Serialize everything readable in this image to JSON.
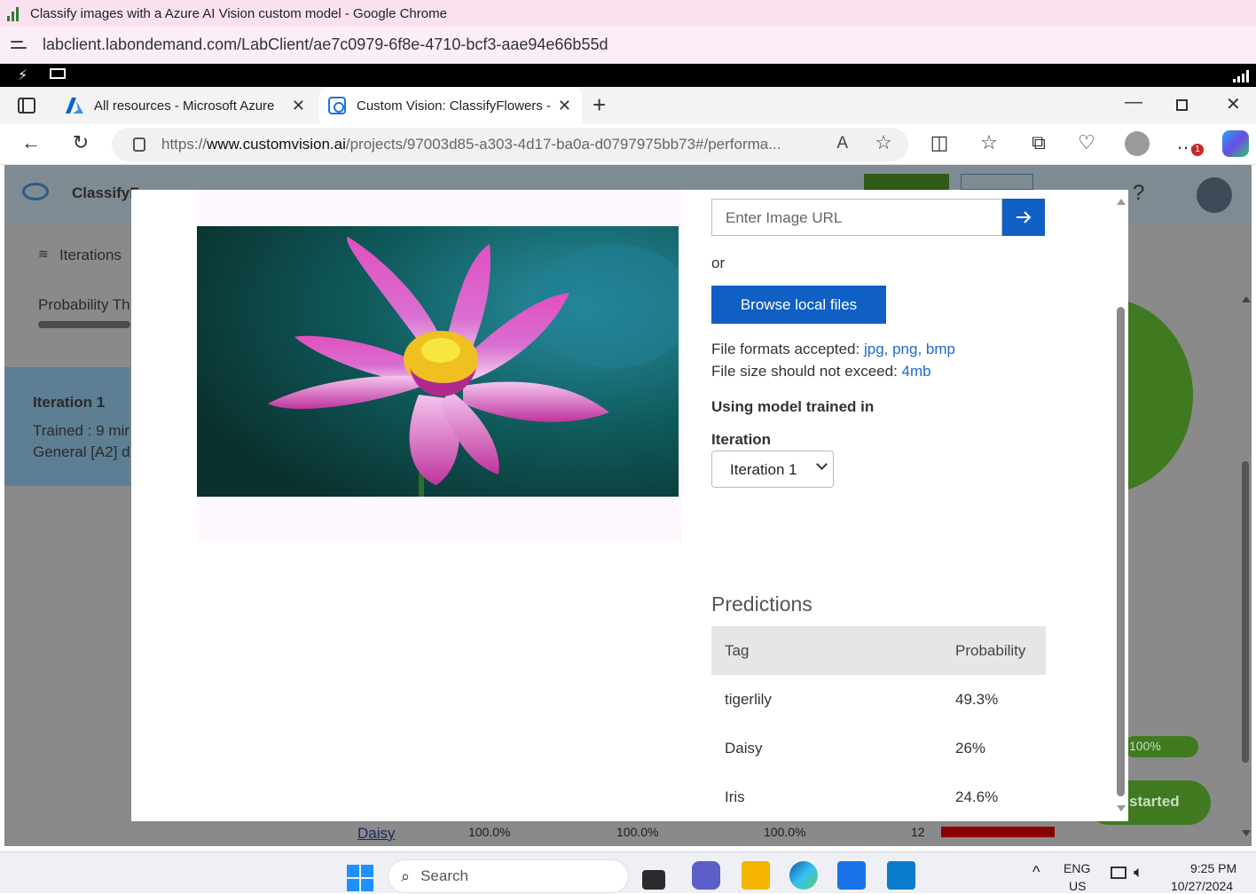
{
  "window": {
    "title": "Classify images with a Azure AI Vision custom model - Google Chrome",
    "url": "labclient.labondemand.com/LabClient/ae7c0979-6f8e-4710-bcf3-aae94e66b55d"
  },
  "edge": {
    "tabs": [
      {
        "label": "All resources - Microsoft Azure"
      },
      {
        "label": "Custom Vision: ClassifyFlowers -"
      }
    ],
    "url_prefix": "https://",
    "url_domain": "www.customvision.ai",
    "url_rest": "/projects/97003d85-a303-4d17-ba0a-d0797975bb73#/performa...",
    "profile_badge": "1"
  },
  "background_app": {
    "project": "ClassifyF",
    "iterations_label": "Iterations",
    "probability_label": "Probability Th",
    "iteration_card": {
      "title": "Iteration 1",
      "trained": "Trained : 9 mir",
      "domain": "General [A2] d"
    },
    "bottom_row": {
      "tag": "Daisy",
      "precision": "100.0%",
      "recall": "100.0%",
      "ap": "100.0%",
      "count": "12"
    },
    "progress_text": "100%",
    "started_button": "started"
  },
  "modal": {
    "url_placeholder": "Enter Image URL",
    "or_text": "or",
    "browse_button": "Browse local files",
    "formats_label": "File formats accepted: ",
    "formats_value": "jpg, png, bmp",
    "size_label": "File size should not exceed: ",
    "size_value": "4mb",
    "model_heading": "Using model trained in",
    "iteration_label": "Iteration",
    "iteration_selected": "Iteration 1",
    "predictions_title": "Predictions",
    "table_headers": {
      "tag": "Tag",
      "probability": "Probability"
    },
    "predictions": [
      {
        "tag": "tigerlily",
        "probability": "49.3%"
      },
      {
        "tag": "Daisy",
        "probability": "26%"
      },
      {
        "tag": "Iris",
        "probability": "24.6%"
      }
    ]
  },
  "taskbar": {
    "search_placeholder": "Search",
    "language": "ENG",
    "region": "US",
    "time": "9:25 PM",
    "date": "10/27/2024"
  },
  "colors": {
    "accent_blue": "#0f5fc4",
    "link_blue": "#1a6bc9",
    "green": "#3f7a20",
    "chrome_pink": "#f9e1ef"
  }
}
